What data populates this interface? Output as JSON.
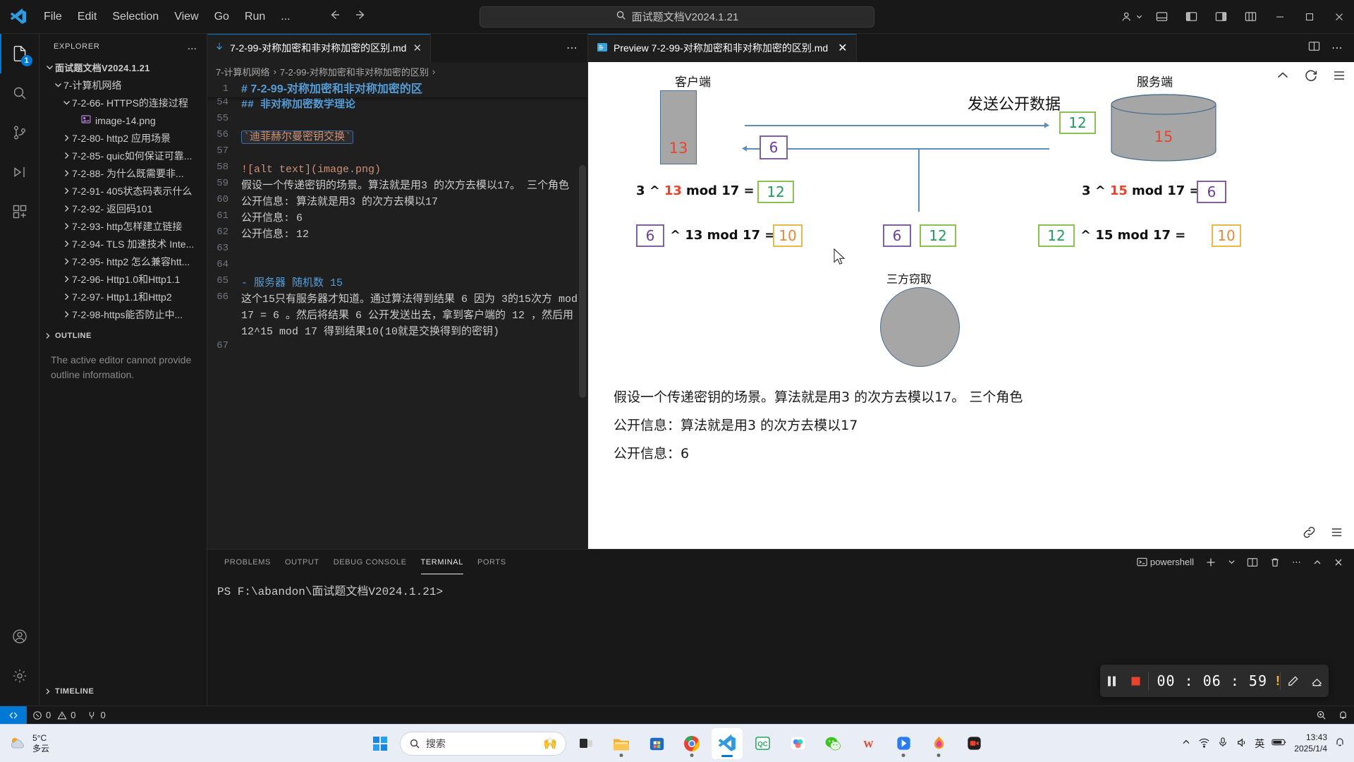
{
  "titlebar": {
    "menus": [
      "File",
      "Edit",
      "Selection",
      "View",
      "Go",
      "Run",
      "..."
    ],
    "search_value": "面试题文档V2024.1.21",
    "search_icon": "search-icon",
    "back_icon": "arrow-left-icon",
    "forward_icon": "arrow-right-icon",
    "accounts_icon": "accounts-icon",
    "layout_icons": [
      "toggle-panel-icon",
      "toggle-primary-sidebar-icon",
      "toggle-secondary-sidebar-icon",
      "customize-layout-icon"
    ],
    "window_controls": [
      "minimize",
      "maximize",
      "close"
    ]
  },
  "activitybar": {
    "items": [
      {
        "name": "explorer",
        "icon": "files-icon",
        "badge": "1",
        "active": true
      },
      {
        "name": "search",
        "icon": "search-icon",
        "badge": "",
        "active": false
      },
      {
        "name": "source-control",
        "icon": "source-control-icon",
        "badge": "",
        "active": false
      },
      {
        "name": "run-and-debug",
        "icon": "debug-icon",
        "badge": "",
        "active": false
      },
      {
        "name": "extensions",
        "icon": "extensions-icon",
        "badge": "",
        "active": false
      }
    ],
    "bottom": [
      {
        "name": "accounts",
        "icon": "account-icon"
      },
      {
        "name": "manage",
        "icon": "gear-icon"
      }
    ]
  },
  "sidebar": {
    "title": "EXPLORER",
    "more_label": "...",
    "tree": [
      {
        "label": "面试题文档V2024.1.21",
        "indent": 1,
        "twisty": "chevron-down",
        "kind": "root"
      },
      {
        "label": "7-计算机网络",
        "indent": 2,
        "twisty": "chevron-down",
        "kind": "folder"
      },
      {
        "label": "7-2-66- HTTPS的连接过程",
        "indent": 3,
        "twisty": "chevron-down",
        "kind": "folder"
      },
      {
        "label": "image-14.png",
        "indent": 4,
        "twisty": "none",
        "kind": "image"
      },
      {
        "label": "7-2-80- http2 应用场景",
        "indent": 3,
        "twisty": "chevron-right",
        "kind": "folder"
      },
      {
        "label": "7-2-85- quic如何保证可靠...",
        "indent": 3,
        "twisty": "chevron-right",
        "kind": "folder"
      },
      {
        "label": "7-2-88- 为什么既需要非...",
        "indent": 3,
        "twisty": "chevron-right",
        "kind": "folder"
      },
      {
        "label": "7-2-91- 405状态码表示什么",
        "indent": 3,
        "twisty": "chevron-right",
        "kind": "folder"
      },
      {
        "label": "7-2-92- 返回码101",
        "indent": 3,
        "twisty": "chevron-right",
        "kind": "folder"
      },
      {
        "label": "7-2-93- http怎样建立链接",
        "indent": 3,
        "twisty": "chevron-right",
        "kind": "folder"
      },
      {
        "label": "7-2-94- TLS 加速技术 Inte...",
        "indent": 3,
        "twisty": "chevron-right",
        "kind": "folder"
      },
      {
        "label": "7-2-95- http2 怎么兼容htt...",
        "indent": 3,
        "twisty": "chevron-right",
        "kind": "folder"
      },
      {
        "label": "7-2-96- Http1.0和Http1.1",
        "indent": 3,
        "twisty": "chevron-right",
        "kind": "folder"
      },
      {
        "label": "7-2-97- Http1.1和Http2",
        "indent": 3,
        "twisty": "chevron-right",
        "kind": "folder"
      },
      {
        "label": "7-2-98-https能否防止中...",
        "indent": 3,
        "twisty": "chevron-right",
        "kind": "folder"
      }
    ],
    "outline_title": "OUTLINE",
    "outline_message": "The active editor cannot provide outline information.",
    "timeline_title": "TIMELINE"
  },
  "editor": {
    "tab_label": "7-2-99-对称加密和非对称加密的区别.md",
    "tab_icon": "markdown-icon",
    "tab_close_icon": "close-icon",
    "tab_more_icon": "more-actions-icon",
    "breadcrumb": [
      "7-计算机网络",
      "7-2-99-对称加密和非对称加密的区别"
    ],
    "sticky_line_number": "1",
    "sticky_line_text": "# 7-2-99-对称加密和非对称加密的区",
    "lines": [
      {
        "n": "53",
        "text": "",
        "type": "blank"
      },
      {
        "n": "54",
        "text": "## 非对称加密数学理论",
        "type": "h2"
      },
      {
        "n": "55",
        "text": "",
        "type": "blank"
      },
      {
        "n": "56",
        "text": "`迪菲赫尔曼密钥交换`",
        "type": "code-inline"
      },
      {
        "n": "57",
        "text": "",
        "type": "blank"
      },
      {
        "n": "58",
        "text": "![alt text](image.png)",
        "type": "md-image"
      },
      {
        "n": "59",
        "text": "假设一个传递密钥的场景。算法就是用3 的次方去模以17。 三个角色",
        "type": "plain"
      },
      {
        "n": "60",
        "text": "公开信息: 算法就是用3 的次方去模以17",
        "type": "plain"
      },
      {
        "n": "61",
        "text": "公开信息: 6",
        "type": "plain"
      },
      {
        "n": "62",
        "text": "公开信息: 12",
        "type": "plain"
      },
      {
        "n": "63",
        "text": "",
        "type": "blank"
      },
      {
        "n": "64",
        "text": "",
        "type": "blank"
      },
      {
        "n": "65",
        "text": "- 服务器 随机数 15",
        "type": "bullet"
      },
      {
        "n": "66",
        "text": "这个15只有服务器才知道。通过算法得到结果 6 因为 3的15次方 mod 17 = 6 。然后将结果 6 公开发送出去，拿到客户端的 12 ，然后用 12^15 mod 17 得到结果10(10就是交换得到的密钥)",
        "type": "plain"
      },
      {
        "n": "67",
        "text": "",
        "type": "blank"
      }
    ]
  },
  "preview": {
    "tab_label": "Preview 7-2-99-对称加密和非对称加密的区别.md",
    "tab_icon": "preview-icon",
    "tab_close_icon": "close-icon",
    "split_icon": "split-editor-icon",
    "more_icon": "more-actions-icon",
    "tools": [
      "collapse-icon",
      "refresh-icon",
      "list-icon"
    ],
    "bottom_tools": [
      "link-icon",
      "list-icon"
    ],
    "diagram": {
      "client_label": "客户端",
      "server_label": "服务端",
      "attacker_label": "三方窃取",
      "arrow_label": "发送公开数据",
      "client_secret": "13",
      "server_secret": "15",
      "client_formula_prefix": "3 ^",
      "client_formula_base": "13",
      "client_formula_mid": "mod 17 =",
      "client_formula_result": "12",
      "server_formula_prefix": "3 ^",
      "server_formula_base": "15",
      "server_formula_mid": "mod 17 =",
      "server_formula_result": "6",
      "client_key_in": "6",
      "client_key_exp": "^ 13 mod 17 =",
      "client_key_out": "10",
      "server_key_in": "12",
      "server_key_exp": "^ 15 mod 17 =",
      "server_key_out": "10",
      "mid_purple": "6",
      "mid_green": "12",
      "top_green": "12",
      "left_purple": "6",
      "colors": {
        "red": "#e8432b",
        "purple": "#6b3fa0",
        "green": "#1f9c5c",
        "orange": "#e8873b",
        "shape_fill": "#a6a6a6",
        "arrow": "#5b8db8"
      }
    },
    "paragraphs": [
      "假设一个传递密钥的场景。算法就是用3 的次方去模以17。 三个角色",
      "公开信息：算法就是用3 的次方去模以17",
      "公开信息：6"
    ]
  },
  "panel": {
    "tabs": [
      "PROBLEMS",
      "OUTPUT",
      "DEBUG CONSOLE",
      "TERMINAL",
      "PORTS"
    ],
    "active_tab": "TERMINAL",
    "shell_label": "powershell",
    "shell_icon": "terminal-powershell-icon",
    "actions": [
      "new-terminal-icon",
      "chevron-down-icon",
      "split-terminal-icon",
      "kill-terminal-icon",
      "more-actions-icon",
      "maximize-panel-icon",
      "close-panel-icon"
    ],
    "prompt": "PS F:\\abandon\\面试题文档V2024.1.21>"
  },
  "recorder": {
    "pause_icon": "pause-icon",
    "stop_icon": "stop-icon",
    "time": "00 : 06 : 59",
    "warning": "!",
    "pen_icon": "pen-icon",
    "eraser_icon": "eraser-icon"
  },
  "statusbar": {
    "remote_icon": "remote-window-icon",
    "errors_icon": "error-icon",
    "errors": "0",
    "warnings_icon": "warning-icon",
    "warnings": "0",
    "ports_icon": "ports-icon",
    "ports": "0",
    "right_items": [
      {
        "name": "zoom-status",
        "icon": "zoom-icon"
      },
      {
        "name": "notifications",
        "icon": "bell-icon"
      }
    ]
  },
  "taskbar": {
    "weather_temp": "5°C",
    "weather_desc": "多云",
    "search_placeholder": "搜索",
    "apps": [
      {
        "name": "start",
        "icon": "windows-icon"
      },
      {
        "name": "task-view",
        "icon": "task-view-icon"
      },
      {
        "name": "file-explorer",
        "icon": "folder-icon"
      },
      {
        "name": "microsoft-store",
        "icon": "store-icon"
      },
      {
        "name": "google-chrome",
        "icon": "chrome-icon"
      },
      {
        "name": "visual-studio-code",
        "icon": "vscode-icon"
      },
      {
        "name": "qc-app",
        "icon": "qc-icon"
      },
      {
        "name": "feishu",
        "icon": "feishu-icon"
      },
      {
        "name": "wechat",
        "icon": "wechat-icon"
      },
      {
        "name": "wps-office",
        "icon": "wps-icon"
      },
      {
        "name": "app-blue",
        "icon": "blue-app-icon"
      },
      {
        "name": "app-flame",
        "icon": "flame-app-icon"
      },
      {
        "name": "app-recorder",
        "icon": "recorder-app-icon"
      }
    ],
    "tray": [
      "chevron-up-icon",
      "network-icon",
      "mic-icon",
      "speaker-icon",
      "ime-icon",
      "battery-icon"
    ],
    "ime_label": "英",
    "clock_time": "13:43",
    "clock_date": "2025/1/4"
  }
}
